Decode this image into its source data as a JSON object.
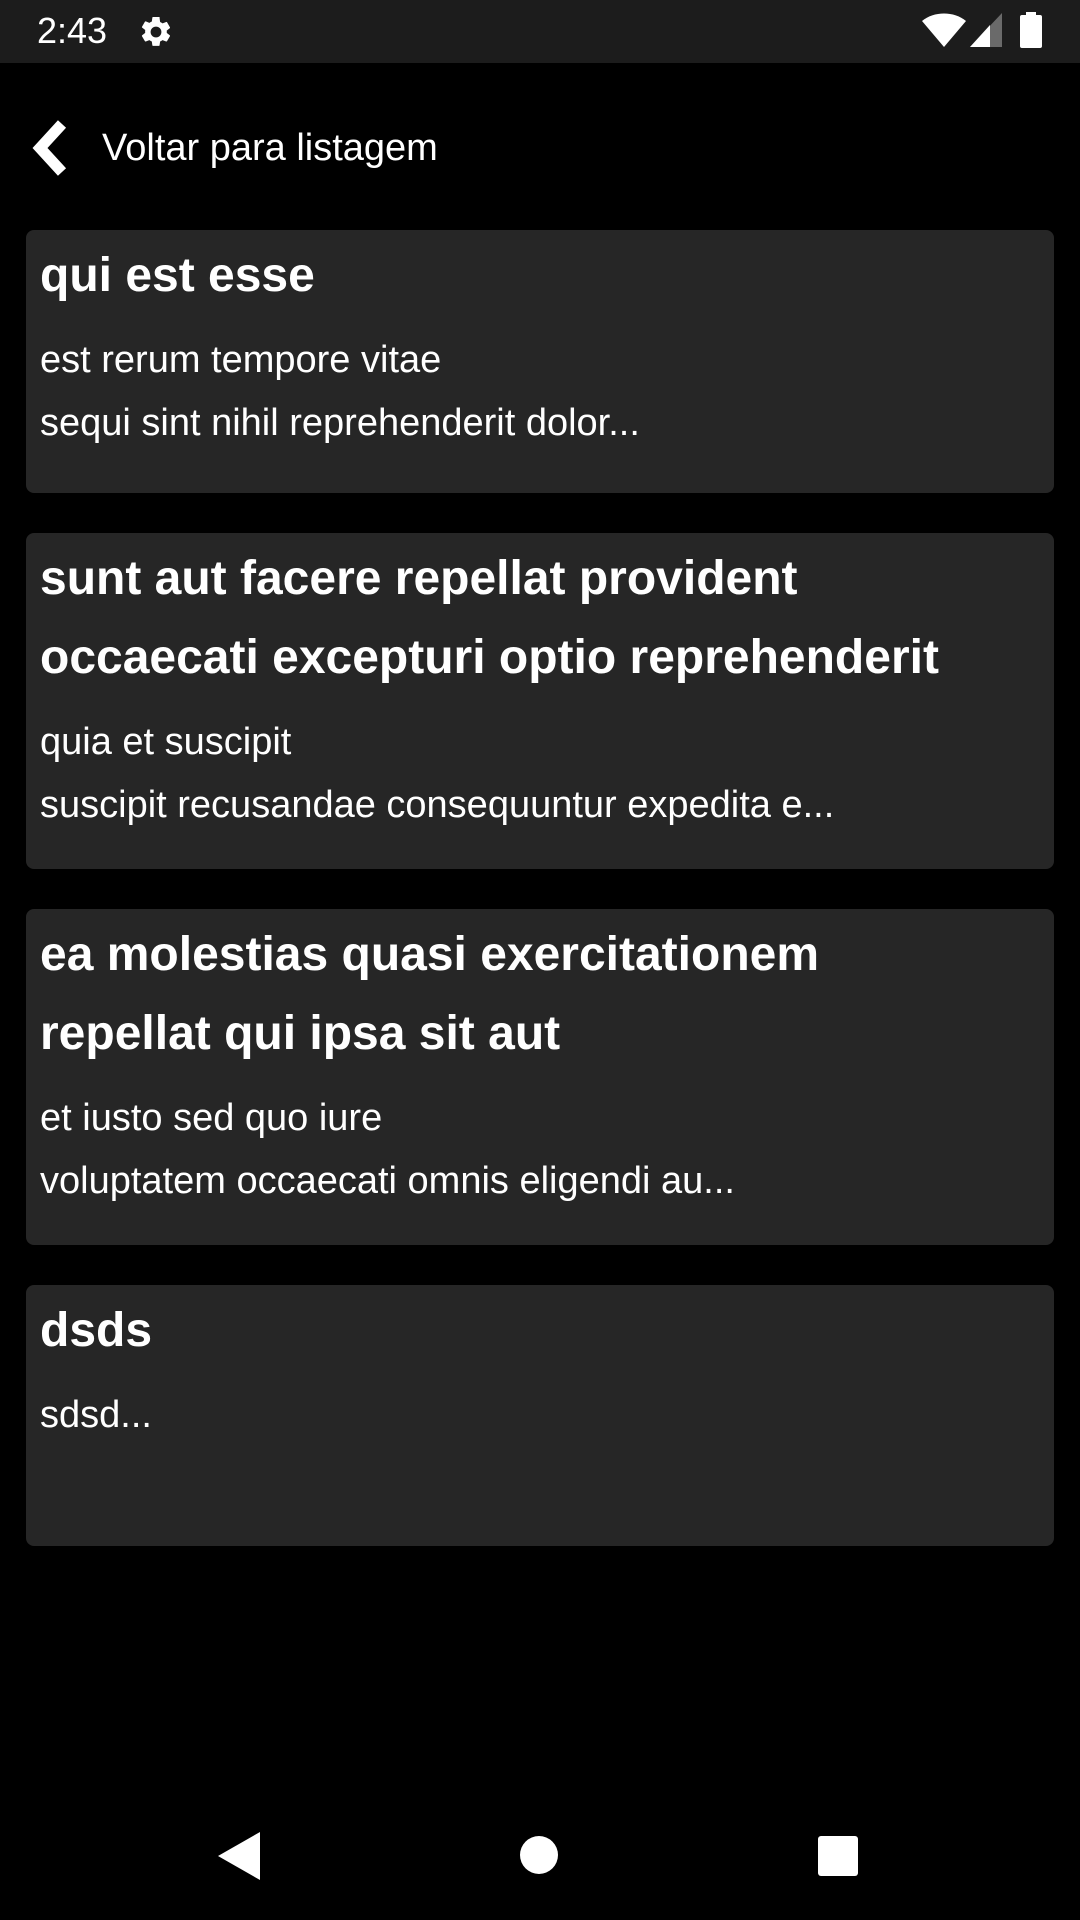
{
  "status_bar": {
    "time": "2:43",
    "icons": [
      "gear-icon",
      "wifi-icon",
      "signal-icon",
      "battery-icon"
    ]
  },
  "header": {
    "back_label": "Voltar para listagem",
    "back_icon": "chevron-left-icon"
  },
  "cards": [
    {
      "title_lines": [
        "qui est esse"
      ],
      "body_lines": [
        "est rerum tempore vitae",
        "sequi sint nihil reprehenderit dolor..."
      ]
    },
    {
      "title_lines": [
        "sunt aut facere repellat provident",
        "occaecati excepturi optio reprehenderit"
      ],
      "body_lines": [
        "quia et suscipit",
        "suscipit recusandae consequuntur expedita e..."
      ]
    },
    {
      "title_lines": [
        "ea molestias quasi exercitationem",
        "repellat qui ipsa sit aut"
      ],
      "body_lines": [
        "et iusto sed quo iure",
        "voluptatem occaecati omnis eligendi au..."
      ]
    },
    {
      "title_lines": [
        "dsds"
      ],
      "body_lines": [
        "sdsd..."
      ]
    }
  ],
  "nav_bar": {
    "icons": [
      "nav-back-icon",
      "nav-home-icon",
      "nav-recents-icon"
    ]
  },
  "colors": {
    "background": "#000000",
    "status_bar": "#1c1c1c",
    "card": "#262626",
    "text": "#ffffff",
    "nav_icon": "#ffffff"
  }
}
